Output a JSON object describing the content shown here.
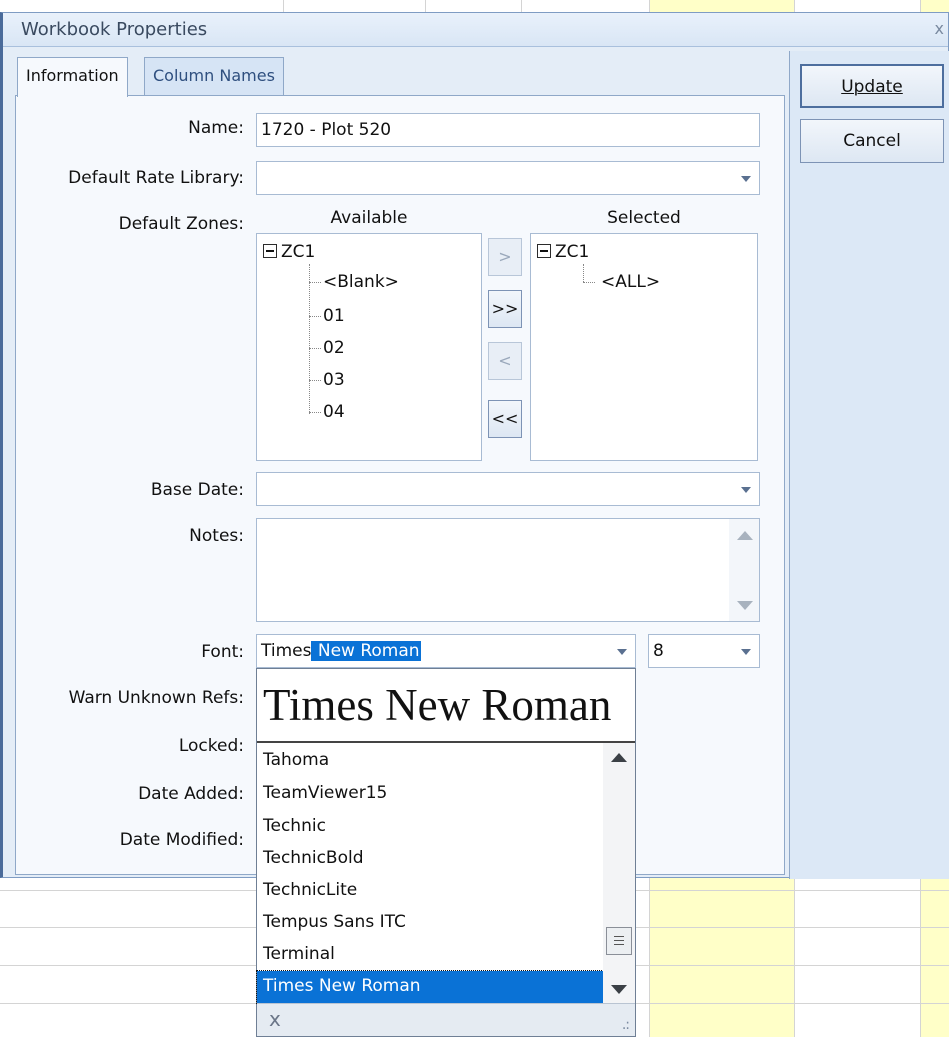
{
  "dialog": {
    "title": "Workbook Properties",
    "close_glyph": "x"
  },
  "tabs": [
    {
      "label": "Information"
    },
    {
      "label": "Column Names"
    }
  ],
  "buttons": {
    "update": "Update",
    "cancel": "Cancel"
  },
  "form": {
    "name_label": "Name:",
    "name_value": "1720 - Plot 520",
    "rate_library_label": "Default Rate Library:",
    "rate_library_value": "",
    "zones_label": "Default Zones:",
    "available_label": "Available",
    "selected_label": "Selected",
    "base_date_label": "Base Date:",
    "base_date_value": "",
    "notes_label": "Notes:",
    "notes_value": "",
    "font_label": "Font:",
    "font_value_plain": "Times",
    "font_value_selected": " New Roman",
    "font_size_value": "8",
    "warn_label": "Warn Unknown Refs:",
    "locked_label": "Locked:",
    "date_added_label": "Date Added:",
    "date_modified_label": "Date Modified:"
  },
  "zones": {
    "available": {
      "root": "ZC1",
      "children": [
        "<Blank>",
        "01",
        "02",
        "03",
        "04"
      ]
    },
    "selected": {
      "root": "ZC1",
      "children": [
        "<ALL>"
      ]
    },
    "move_buttons": [
      ">",
      ">>",
      "<",
      "<<"
    ]
  },
  "font_dropdown": {
    "preview": "Times New Roman",
    "items": [
      "Tahoma",
      "TeamViewer15",
      "Technic",
      "TechnicBold",
      "TechnicLite",
      "Tempus Sans ITC",
      "Terminal",
      "Times New Roman"
    ],
    "selected_index": 7,
    "clear_glyph": "x"
  },
  "colors": {
    "accent": "#0a72d6",
    "sheet_yellow": "#ffffc8",
    "dialog_bg": "#e4edf7"
  }
}
